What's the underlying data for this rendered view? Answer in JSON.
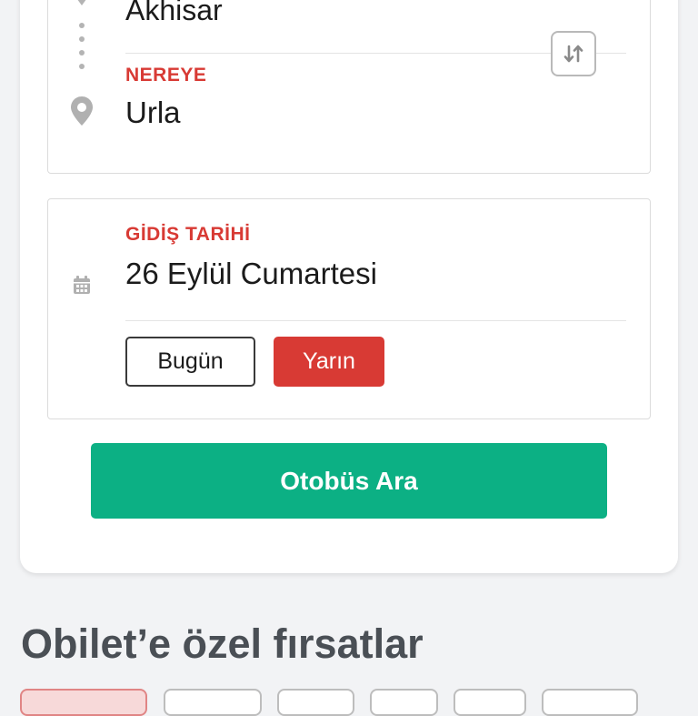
{
  "route": {
    "from_value": "Akhisar",
    "to_label": "NEREYE",
    "to_value": "Urla",
    "swap_icon": "swap-vertical-icon"
  },
  "date": {
    "label": "GİDİŞ TARİHİ",
    "value": "26 Eylül Cumartesi",
    "today_label": "Bugün",
    "tomorrow_label": "Yarın",
    "selected": "Yarın"
  },
  "search": {
    "button_label": "Otobüs Ara"
  },
  "deals": {
    "title": "Obilet’e özel fırsatlar",
    "chips": [
      "",
      "",
      "",
      "",
      "",
      ""
    ]
  },
  "colors": {
    "accent_red": "#d83a34",
    "primary_green": "#0cb084",
    "title_gray": "#4a4f55"
  }
}
